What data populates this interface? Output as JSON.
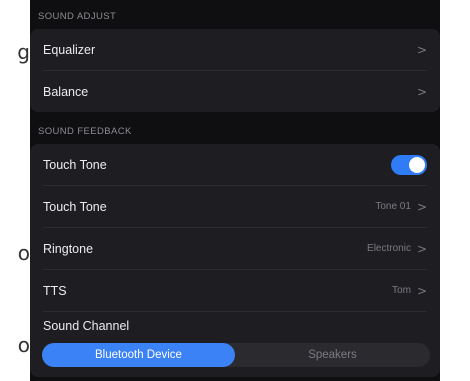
{
  "edge_glyphs": [
    "g",
    "o",
    "o"
  ],
  "sound_adjust": {
    "title": "SOUND ADJUST",
    "items": [
      {
        "label": "Equalizer",
        "chevron": ">"
      },
      {
        "label": "Balance",
        "chevron": ">"
      }
    ]
  },
  "sound_feedback": {
    "title": "SOUND FEEDBACK",
    "touch_tone_toggle": {
      "label": "Touch Tone",
      "on": true
    },
    "items": [
      {
        "label": "Touch Tone",
        "value": "Tone 01",
        "chevron": ">"
      },
      {
        "label": "Ringtone",
        "value": "Electronic",
        "chevron": ">"
      },
      {
        "label": "TTS",
        "value": "Tom",
        "chevron": ">"
      }
    ],
    "sound_channel": {
      "label": "Sound Channel",
      "options": [
        "Bluetooth Device",
        "Speakers"
      ],
      "selected": "Bluetooth Device"
    }
  },
  "colors": {
    "accent": "#3b82f6",
    "panel_bg": "#0f0f11",
    "card_bg": "#1e1e22"
  }
}
